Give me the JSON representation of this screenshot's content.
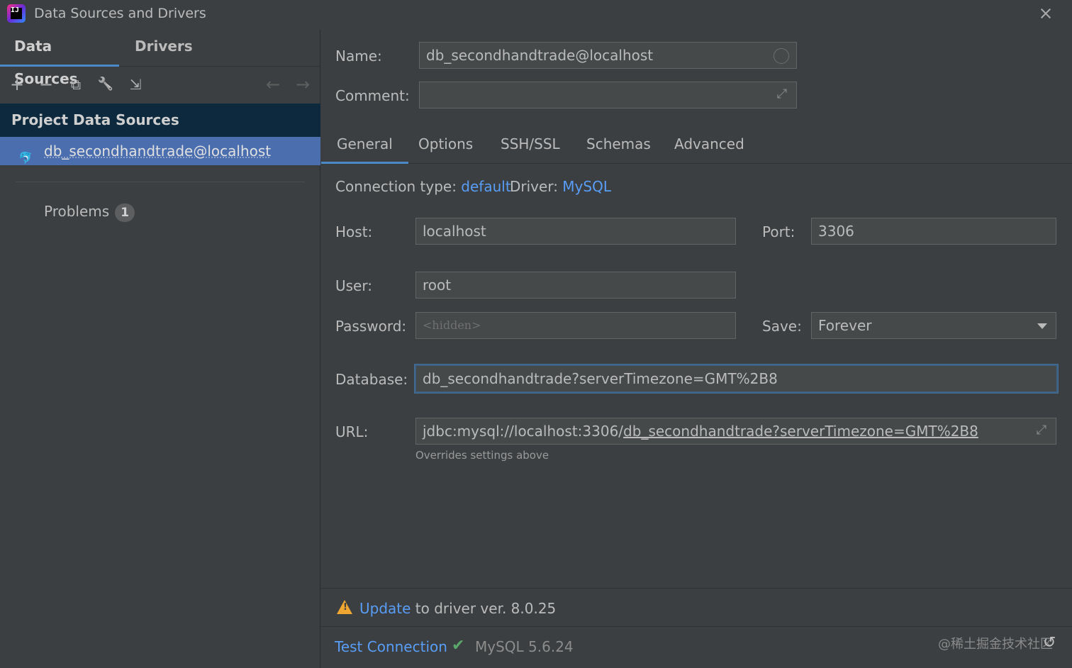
{
  "window": {
    "title": "Data Sources and Drivers",
    "app_icon_text": "IJ"
  },
  "left": {
    "tabs": [
      {
        "label": "Data Sources",
        "active": true
      },
      {
        "label": "Drivers",
        "active": false
      }
    ],
    "toolbar": {
      "add": "+",
      "remove": "−",
      "duplicate": "⧉",
      "wrench": "🔧",
      "import": "⇲",
      "back": "←",
      "forward": "→"
    },
    "tree_header": "Project Data Sources",
    "selected_item": "db_secondhandtrade@localhost",
    "problems_label": "Problems",
    "problems_count": "1"
  },
  "right": {
    "name_label": "Name:",
    "name_value": "db_secondhandtrade@localhost",
    "comment_label": "Comment:",
    "comment_value": "",
    "tabs": [
      "General",
      "Options",
      "SSH/SSL",
      "Schemas",
      "Advanced"
    ],
    "connection_type_label": "Connection type:",
    "connection_type_value": "default",
    "driver_label": "Driver:",
    "driver_value": "MySQL",
    "host_label": "Host:",
    "host_value": "localhost",
    "port_label": "Port:",
    "port_value": "3306",
    "user_label": "User:",
    "user_value": "root",
    "password_label": "Password:",
    "password_placeholder": "<hidden>",
    "save_label": "Save:",
    "save_value": "Forever",
    "database_label": "Database:",
    "database_value": "db_secondhandtrade?serverTimezone=GMT%2B8",
    "url_label": "URL:",
    "url_prefix": "jdbc:mysql://localhost:3306/",
    "url_suffix": "db_secondhandtrade?serverTimezone=GMT%2B8",
    "url_hint": "Overrides settings above",
    "update_link": "Update",
    "update_text": " to driver ver. 8.0.25",
    "test_connection": "Test Connection",
    "test_result": "MySQL 5.6.24",
    "watermark": "@稀土掘金技术社区"
  },
  "colors": {
    "accent": "#4a88c7",
    "link": "#589df6",
    "selection": "#4b6eaf",
    "success": "#59a869",
    "warning": "#f0a732"
  }
}
